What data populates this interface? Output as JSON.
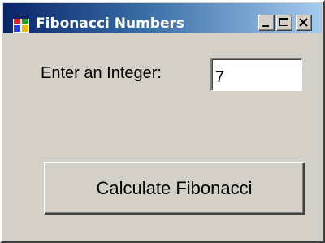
{
  "window": {
    "title": "Fibonacci Numbers",
    "app_icon": "windows-form-icon",
    "controls": {
      "minimize_icon": "minimize-icon",
      "maximize_icon": "maximize-icon",
      "close_icon": "close-icon"
    }
  },
  "form": {
    "input_label": "Enter an Integer:",
    "input_value": "7",
    "calculate_label": "Calculate Fibonacci"
  },
  "colors": {
    "titlebar_start": "#0a246a",
    "titlebar_end": "#a6caf0",
    "surface": "#d4d0c8"
  }
}
